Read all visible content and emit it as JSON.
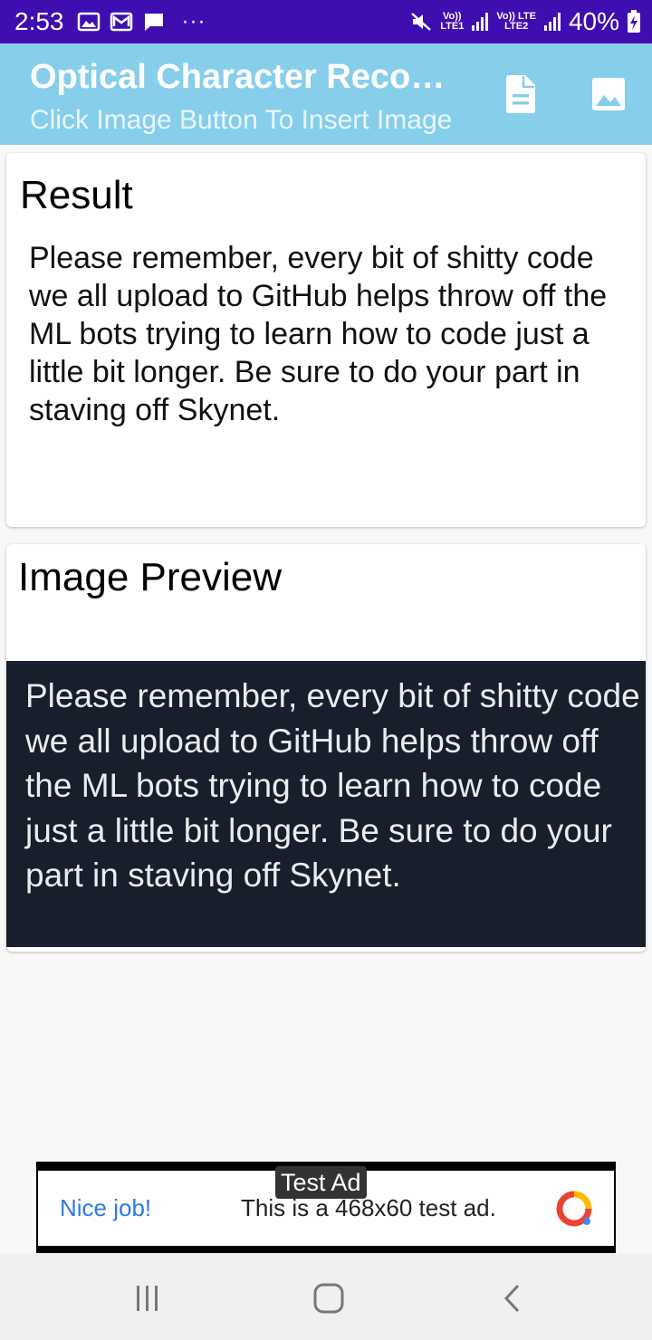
{
  "status_bar": {
    "time": "2:53",
    "icons": [
      "image-icon",
      "gmail-icon",
      "message-icon"
    ],
    "overflow": "···",
    "sim1": "Vo))\nLTE1",
    "sim2": "Vo)) LTE\nLTE2",
    "battery": "40%"
  },
  "app_bar": {
    "title": "Optical Character Recognition",
    "subtitle": "Click Image Button To Insert Image",
    "actions": [
      "document-icon",
      "image-icon"
    ]
  },
  "result_card": {
    "title": "Result",
    "text": "Please remember, every bit of shitty code we all upload to GitHub helps throw off the ML bots trying to learn how to code just a little bit longer. Be sure to do your part in staving off Skynet."
  },
  "preview_card": {
    "title": "Image Preview",
    "image_text": "Please remember, every bit of shitty code we all upload to GitHub helps throw off the ML bots trying to learn how to code just a little bit longer. Be sure to do your part in staving off Skynet."
  },
  "ad": {
    "tag": "Test Ad",
    "left_text": "Nice job!",
    "center_text": "This is a 468x60 test ad."
  },
  "nav_bar": {
    "buttons": [
      "recent-apps-icon",
      "home-icon",
      "back-icon"
    ]
  },
  "colors": {
    "status_bar": "#3f0eb1",
    "app_bar": "#87ceeb",
    "preview_bg": "#161f2b",
    "ad_link": "#2c79e6"
  }
}
